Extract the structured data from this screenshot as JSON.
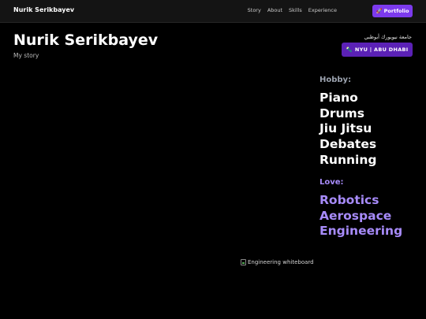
{
  "nav": {
    "brand": "Nurik Serikbayev",
    "links": [
      "Story",
      "About",
      "Skills",
      "Experience"
    ],
    "cta_icon": "🚀",
    "cta_label": "Portfolio"
  },
  "header": {
    "title": "Nurik Serikbayev",
    "subtitle": "My story"
  },
  "affiliation": {
    "arabic_text": "جامعة نيويورك أبوظبي",
    "badge_icon": "🔦",
    "badge_label": "NYU | ABU DHABI"
  },
  "hobby": {
    "heading": "Hobby:",
    "items": [
      "Piano",
      "Drums",
      "Jiu Jitsu",
      "Debates",
      "Running"
    ]
  },
  "love": {
    "heading": "Love:",
    "items": [
      "Robotics",
      "Aerospace",
      "Engineering"
    ]
  },
  "image": {
    "alt": "Engineering whiteboard"
  },
  "colors": {
    "accent": "#7c3aed",
    "badge": "#5b21b6",
    "love_text": "#a78bfa",
    "hobby_heading": "#9ca3af",
    "background": "#000000"
  }
}
